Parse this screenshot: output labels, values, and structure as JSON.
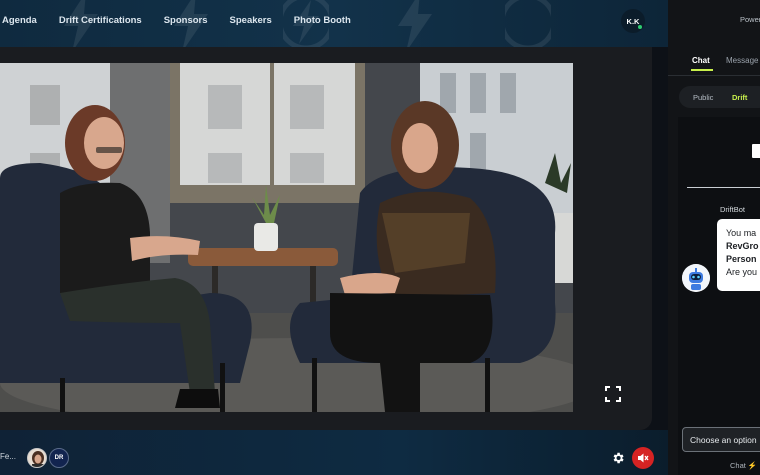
{
  "nav": {
    "items": [
      {
        "label": "Agenda"
      },
      {
        "label": "Drift Certifications"
      },
      {
        "label": "Sponsors"
      },
      {
        "label": "Speakers"
      },
      {
        "label": "Photo Booth"
      }
    ]
  },
  "user": {
    "initials": "K.K",
    "status_color": "#2ecc71"
  },
  "stage": {
    "room_name": "Fe...",
    "participant_badge": "DR",
    "mute_color": "#d62323"
  },
  "panel": {
    "powered_by": "Power",
    "tabs": [
      {
        "label": "Chat"
      },
      {
        "label": "Message"
      }
    ],
    "filters": [
      {
        "label": "Public"
      },
      {
        "label": "Drift"
      }
    ],
    "bot_name": "DriftBot",
    "message_lines": [
      {
        "text": "You ma",
        "bold": false
      },
      {
        "text": "RevGro",
        "bold": true
      },
      {
        "text": "Person",
        "bold": true
      },
      {
        "text": "Are you",
        "bold": false
      }
    ],
    "choose_option": "Choose an option",
    "chat_by": "Chat ⚡"
  },
  "colors": {
    "accent": "#c8f04c",
    "nav_bg": "#12324a",
    "panel_bg": "#121417"
  }
}
